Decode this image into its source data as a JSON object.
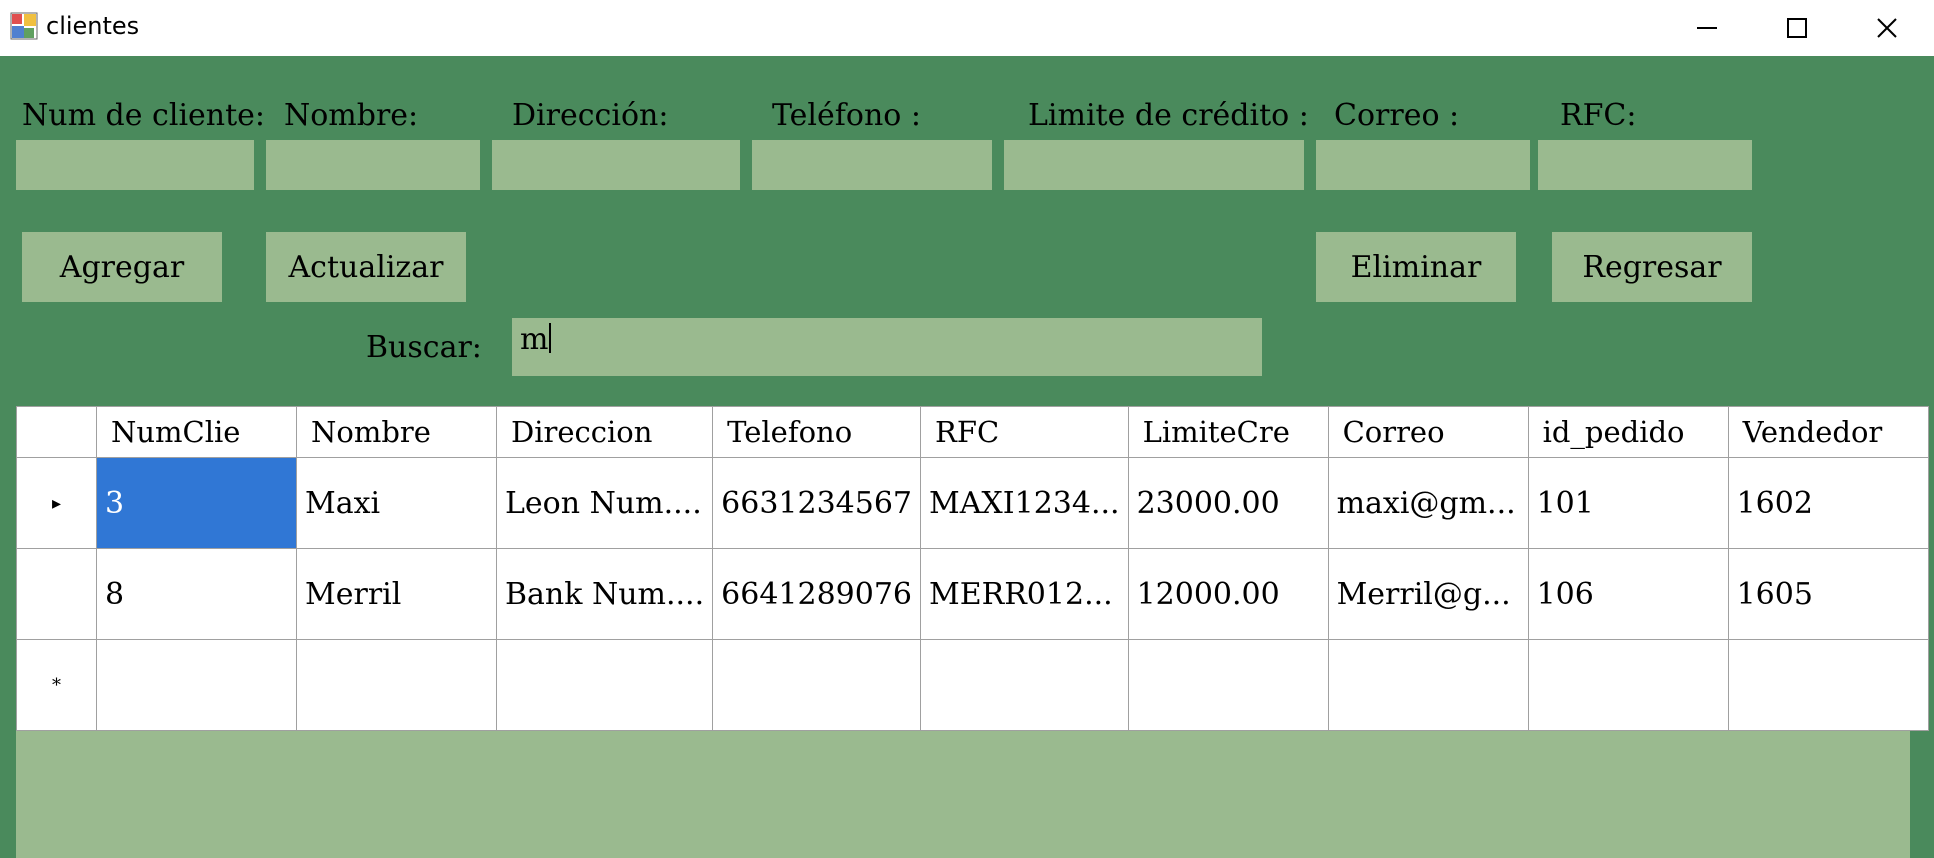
{
  "window": {
    "title": "clientes",
    "minimize_icon": "minimize-icon",
    "maximize_icon": "maximize-icon",
    "close_icon": "close-icon"
  },
  "colors": {
    "background": "#4a8a5c",
    "field": "#9aba8f",
    "selection": "#3077d5"
  },
  "form": {
    "labels": [
      "Num de cliente:",
      "Nombre:",
      "Dirección:",
      "Teléfono :",
      "Limite de crédito :",
      "Correo :",
      "RFC:"
    ],
    "values": [
      "",
      "",
      "",
      "",
      "",
      "",
      ""
    ]
  },
  "buttons": {
    "agregar": "Agregar",
    "actualizar": "Actualizar",
    "eliminar": "Eliminar",
    "regresar": "Regresar"
  },
  "search": {
    "label": "Buscar:",
    "value": "m"
  },
  "grid": {
    "columns": [
      "NumClie",
      "Nombre",
      "Direccion",
      "Telefono",
      "RFC",
      "LimiteCre",
      "Correo",
      "id_pedido",
      "Vendedor"
    ],
    "rows": [
      [
        "3",
        "Maxi",
        "Leon Num....",
        "6631234567",
        "MAXI1234...",
        "23000.00",
        "maxi@gm...",
        "101",
        "1602"
      ],
      [
        "8",
        "Merril",
        "Bank Num....",
        "6641289076",
        "MERR012...",
        "12000.00",
        "Merril@g...",
        "106",
        "1605"
      ]
    ],
    "current_row_marker": "▸",
    "new_row_marker": "*"
  }
}
